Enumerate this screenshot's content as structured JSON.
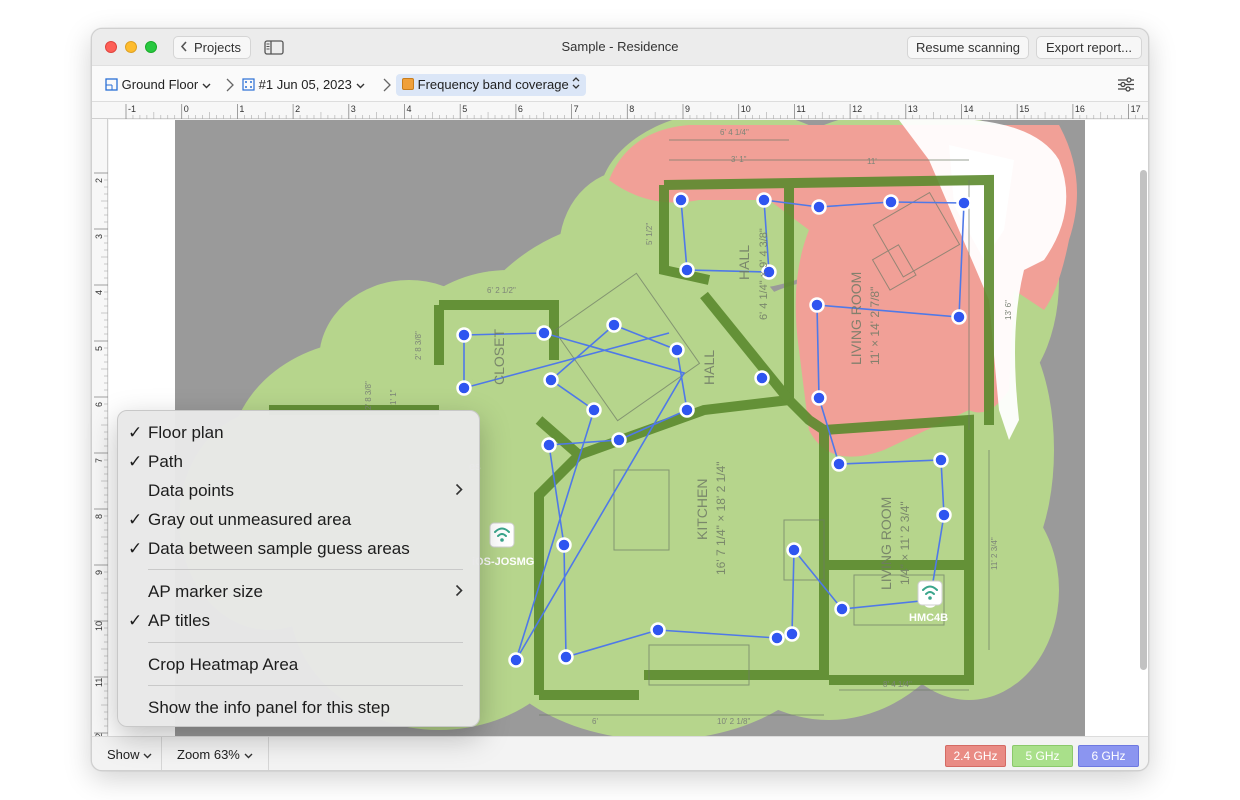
{
  "window": {
    "title": "Sample - Residence",
    "back_label": "Projects",
    "resume_label": "Resume scanning",
    "export_label": "Export report..."
  },
  "breadcrumbs": {
    "floor": "Ground Floor",
    "scan": "#1 Jun 05, 2023",
    "visualization": "Frequency band coverage"
  },
  "ruler": {
    "top": [
      "-1",
      "0",
      "1",
      "2",
      "3",
      "4",
      "5",
      "6",
      "7",
      "8",
      "9",
      "10",
      "11",
      "12",
      "13",
      "14",
      "15",
      "16",
      "17"
    ],
    "left": [
      "2",
      "3",
      "4",
      "5",
      "6",
      "7",
      "8",
      "9",
      "10",
      "11",
      "12"
    ]
  },
  "rooms": {
    "closet": "CLOSET",
    "hall_upper": "HALL",
    "hall_upper_dim": "6' 4 1/4\" × 9' 4 3/8\"",
    "hall_mid": "HALL",
    "living_top": "LIVING ROOM",
    "living_top_dim": "11' × 14' 2 7/8\"",
    "kitchen": "KITCHEN",
    "kitchen_dim": "16' 7 1/4\" × 18' 2 1/4\"",
    "living_bottom": "LIVING ROOM",
    "living_bottom_dim": "1/4\" × 11' 2 3/4\""
  },
  "dims": {
    "top_left": "6' 4 1/4\"",
    "top_inner": "3' 1\"",
    "top_right": "11'",
    "closet_w": "6' 2 1/2\"",
    "right_side": "13' 6\"",
    "right_lower": "11' 2 3/4\"",
    "bottom_right": "8' 4 1/4\"",
    "bottom_mid": "10' 2 1/8\"",
    "bottom_left": "6'",
    "left_a": "2' 8 3/8\"",
    "left_b": "2' 8 3/8\"",
    "left_c": "1' 1\"",
    "left_d": "5' 1/2\"",
    "partial_label": "es"
  },
  "access_points": [
    {
      "title": "iOS-JOSMG"
    },
    {
      "title": "HMC4B"
    }
  ],
  "menu": {
    "items": [
      {
        "label": "Floor plan",
        "checked": true
      },
      {
        "label": "Path",
        "checked": true
      },
      {
        "label": "Data points",
        "checked": false,
        "submenu": true
      },
      {
        "label": "Gray out unmeasured area",
        "checked": true
      },
      {
        "label": "Data between sample guess areas",
        "checked": true
      },
      {
        "label": "AP marker size",
        "checked": false,
        "submenu": true
      },
      {
        "label": "AP titles",
        "checked": true
      },
      {
        "label": "Crop Heatmap Area",
        "checked": false
      },
      {
        "label": "Show the info panel for this step",
        "checked": false
      }
    ],
    "check_glyph": "✓",
    "submenu_glyph": "›"
  },
  "bottom": {
    "show_label": "Show",
    "zoom_label": "Zoom 63%",
    "bands": [
      {
        "label": "2.4 GHz",
        "color": "#e98b84",
        "border": "#d46a63"
      },
      {
        "label": "5 GHz",
        "color": "#a9e08a",
        "border": "#8ac96a"
      },
      {
        "label": "6 GHz",
        "color": "#8b95f0",
        "border": "#6d78e0"
      }
    ]
  },
  "colors": {
    "coverage_5ghz": "#b6d58c",
    "coverage_24ghz": "#f1a097",
    "unmeasured": "#9a9a9a",
    "wall": "#5c8a2e",
    "path": "#4f79e8",
    "point": "#2f55f0",
    "accent": "#1a73e8"
  },
  "icons": {
    "back": "chevron-left-icon",
    "sidebar": "sidebar-icon",
    "floor": "floorplan-icon",
    "scan": "scan-grid-icon",
    "viz": "orange-square-icon",
    "settings": "sliders-icon",
    "ap": "wifi-icon"
  }
}
